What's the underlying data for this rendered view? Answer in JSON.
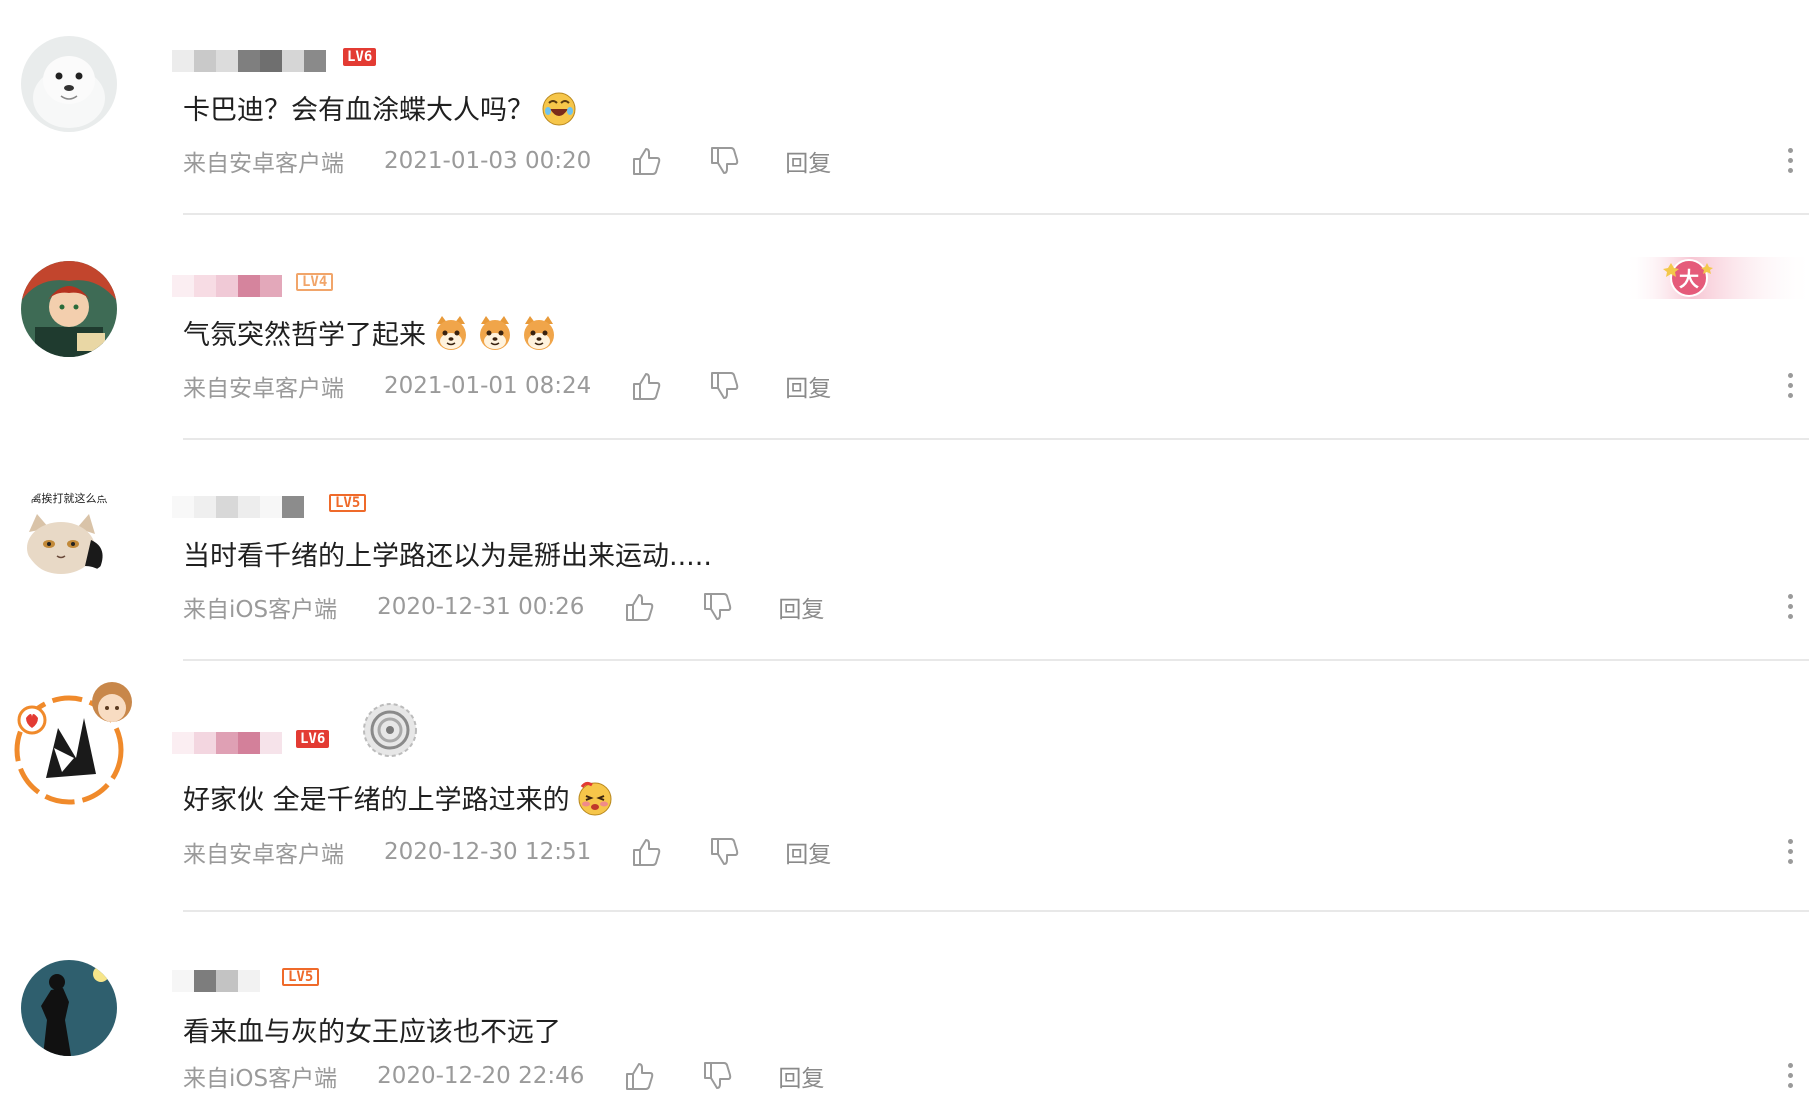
{
  "comments": [
    {
      "level": "LV6",
      "content": "卡巴迪？会有血涂蝶大人吗？",
      "emoji": [
        "laughing-face-emoji"
      ],
      "source": "来自安卓客户端",
      "time": "2021-01-03 00:20",
      "reply_label": "回复",
      "avatar_icon": "seal-avatar"
    },
    {
      "level": "LV4",
      "content": "气氛突然哲学了起来",
      "emoji": [
        "shiba-dog-emoji",
        "shiba-dog-emoji",
        "shiba-dog-emoji"
      ],
      "source": "来自安卓客户端",
      "time": "2021-01-01 08:24",
      "reply_label": "回复",
      "avatar_icon": "anime-boy-avatar",
      "medal_text": "大"
    },
    {
      "level": "LV5",
      "content": "当时看千绪的上学路还以为是掰出来运动.....",
      "emoji": [],
      "source": "来自iOS客户端",
      "time": "2020-12-31 00:26",
      "reply_label": "回复",
      "avatar_icon": "cat-avatar",
      "avatar_caption": "离挨打就这么点"
    },
    {
      "level": "LV6",
      "content": "好家伙 全是千绪的上学路过来的",
      "emoji": [
        "blushing-face-emoji"
      ],
      "source": "来自安卓客户端",
      "time": "2020-12-30 12:51",
      "reply_label": "回复",
      "avatar_icon": "ink-art-avatar"
    },
    {
      "level": "LV5",
      "content": "看来血与灰的女王应该也不远了",
      "emoji": [],
      "source": "来自iOS客户端",
      "time": "2020-12-20 22:46",
      "reply_label": "回复",
      "avatar_icon": "silhouette-avatar"
    }
  ],
  "colors": {
    "text": "#202020",
    "meta": "#9a9a9a",
    "divider": "#e8e8e8",
    "lv6": "#e33b33",
    "lv5": "#ef6a2a",
    "lv4": "#f1a56a"
  }
}
